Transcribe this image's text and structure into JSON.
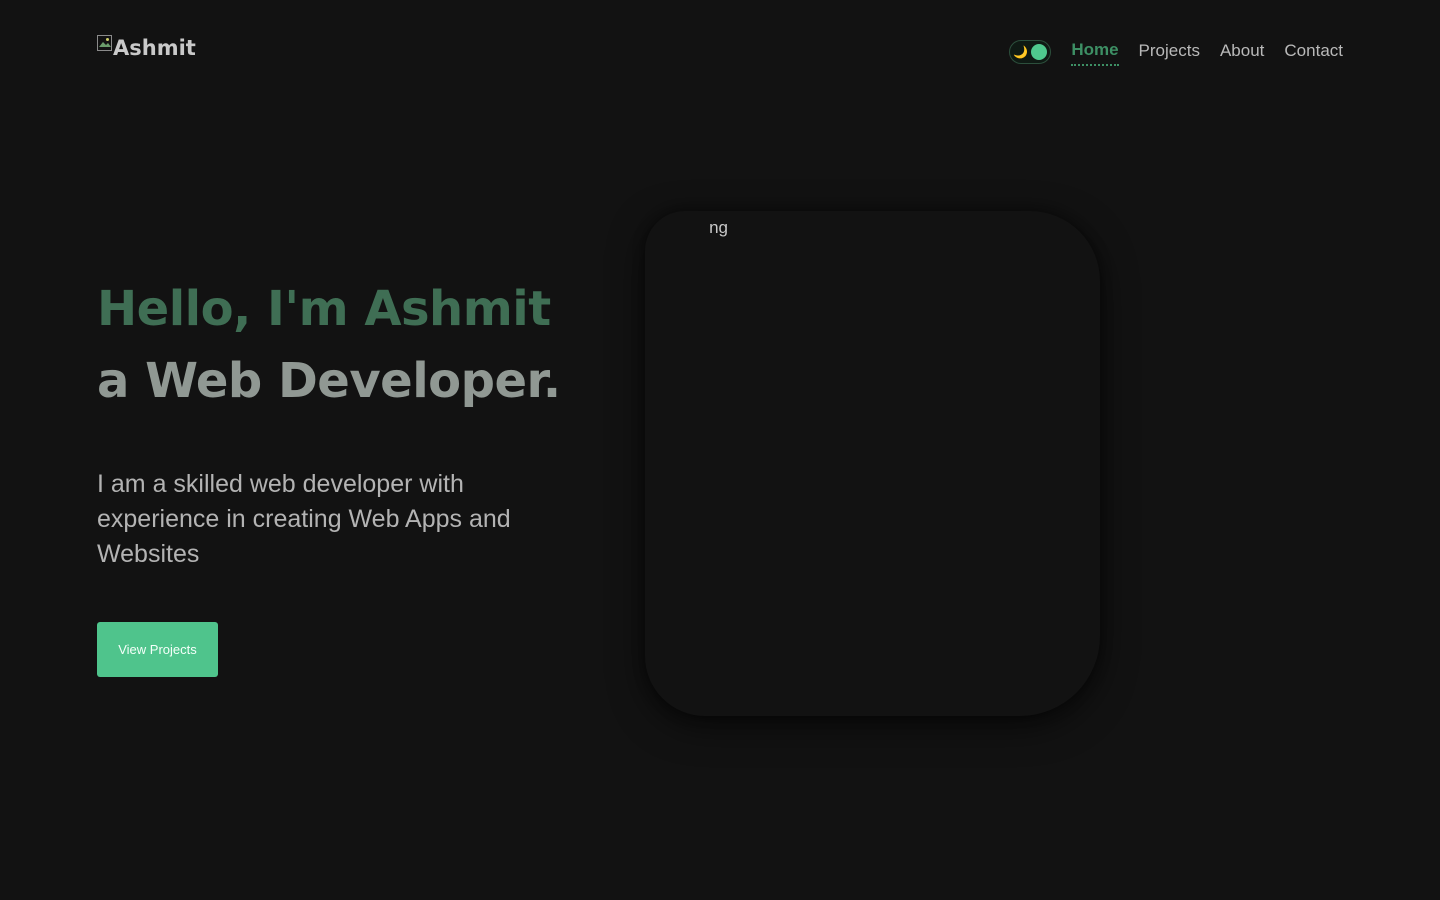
{
  "header": {
    "logo_alt": "Ashmit",
    "theme_toggle_icon": "moon-icon",
    "nav": {
      "home": "Home",
      "projects": "Projects",
      "about": "About",
      "contact": "Contact"
    }
  },
  "hero": {
    "greeting": "Hello, I'm Ashmit",
    "role": "a Web Developer.",
    "description": "I am a skilled web developer with experience in creating Web Apps and Websites",
    "cta_label": "View Projects",
    "image_alt_fragment": "ng"
  },
  "colors": {
    "background": "#121212",
    "accent": "#4fc48c",
    "greeting": "#3f6e54",
    "role": "#909893",
    "active_nav": "#3d8f64"
  }
}
